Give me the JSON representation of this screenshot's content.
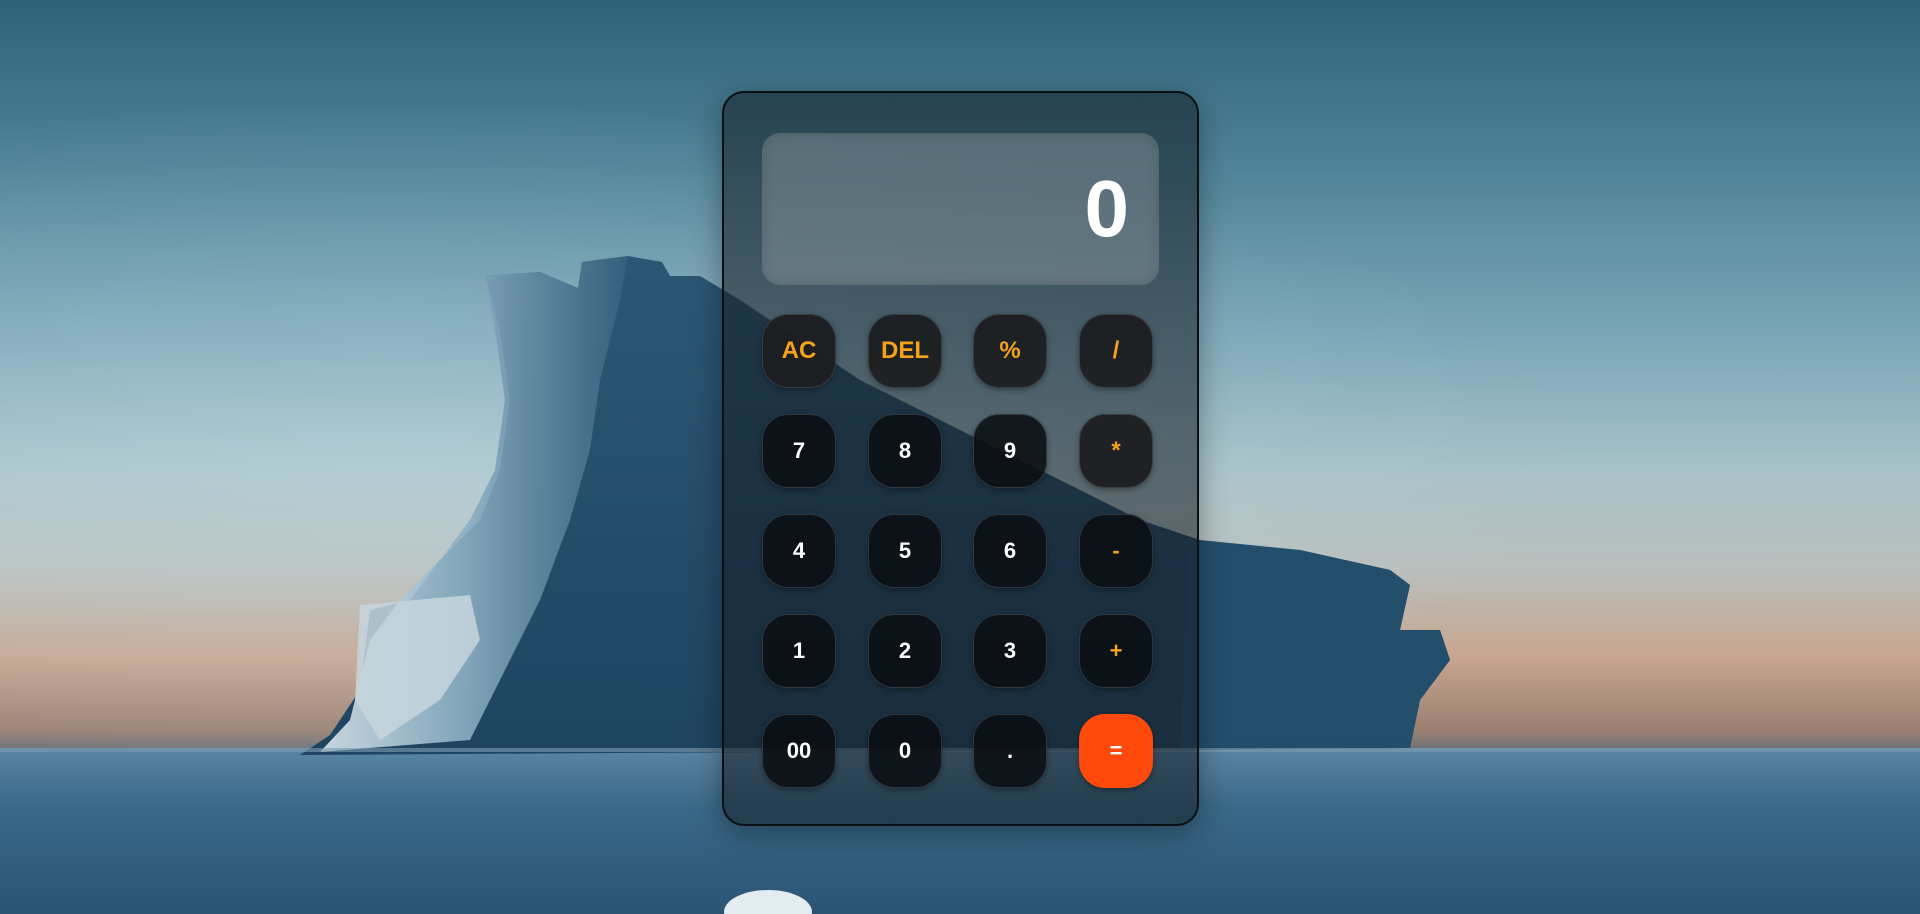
{
  "display": {
    "value": "0"
  },
  "keys": {
    "ac": "AC",
    "del": "DEL",
    "percent": "%",
    "divide": "/",
    "seven": "7",
    "eight": "8",
    "nine": "9",
    "multiply": "*",
    "four": "4",
    "five": "5",
    "six": "6",
    "minus": "-",
    "one": "1",
    "two": "2",
    "three": "3",
    "plus": "+",
    "double_zero": "00",
    "zero": "0",
    "decimal": ".",
    "equals": "="
  },
  "colors": {
    "operator": "#f5a21a",
    "equals": "#ff4a0c",
    "digit": "#ffffff"
  }
}
